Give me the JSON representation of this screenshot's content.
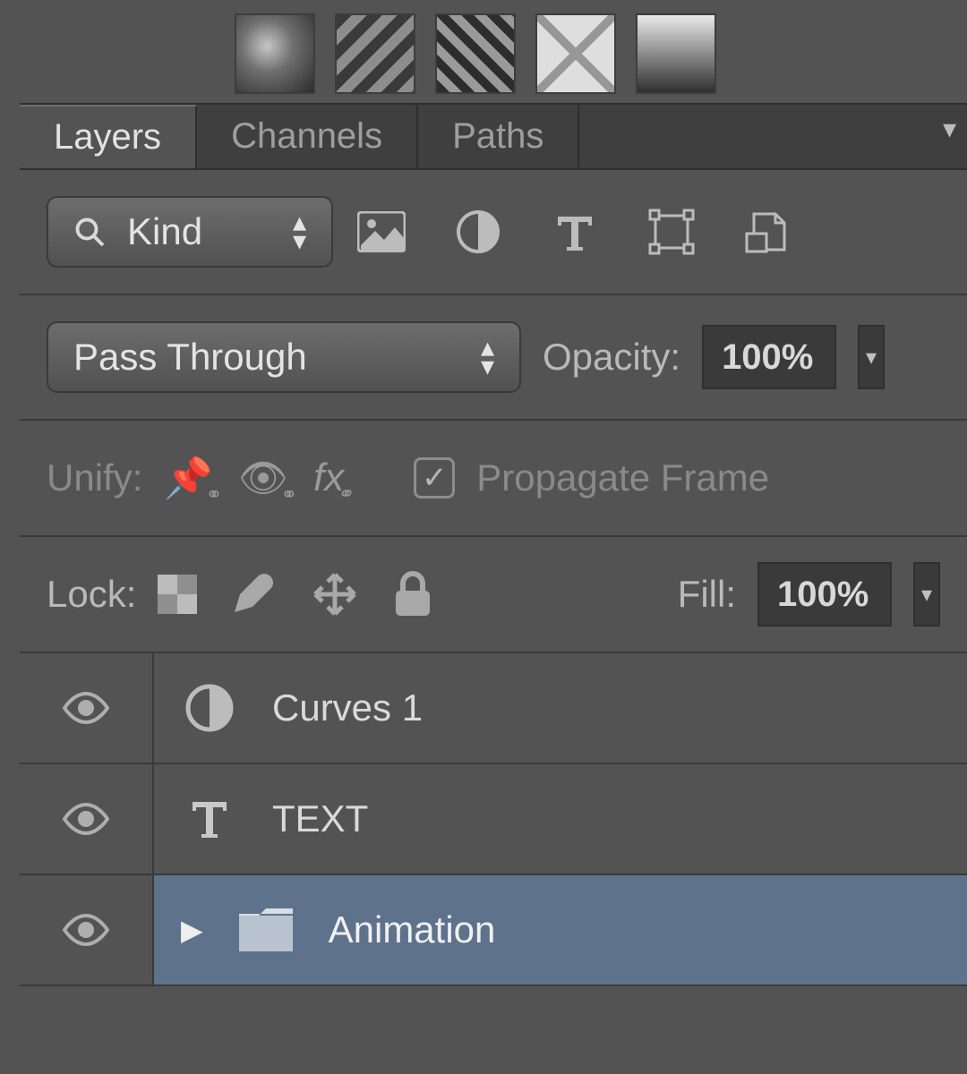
{
  "tabs": {
    "layers": "Layers",
    "channels": "Channels",
    "paths": "Paths"
  },
  "filter": {
    "label": "Kind"
  },
  "blend": {
    "mode": "Pass Through",
    "opacity_label": "Opacity:",
    "opacity_value": "100%"
  },
  "unify": {
    "label": "Unify:",
    "propagate_label": "Propagate Frame"
  },
  "lock": {
    "label": "Lock:",
    "fill_label": "Fill:",
    "fill_value": "100%"
  },
  "layers": [
    {
      "name": "Curves 1",
      "icon": "adjustment",
      "selected": false
    },
    {
      "name": "TEXT",
      "icon": "type",
      "selected": false
    },
    {
      "name": "Animation",
      "icon": "folder",
      "selected": true
    }
  ]
}
